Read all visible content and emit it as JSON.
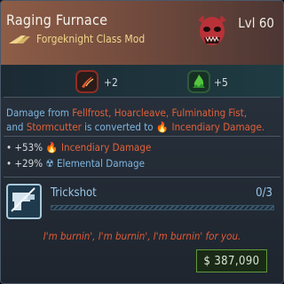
{
  "item": {
    "name": "Raging Furnace",
    "type": "Forgeknight Class Mod",
    "level_text": "Lvl 60"
  },
  "skills": [
    {
      "icon": "fire-claw-icon",
      "count": "+2"
    },
    {
      "icon": "green-flame-icon",
      "count": "+5"
    }
  ],
  "description": {
    "part1": "Damage from ",
    "sources": "Fellfrost, Hoarcleave, Fulminating Fist,",
    "and": "and ",
    "source_last": "Stormcutter",
    "converted": " is converted to ",
    "target": "Incendiary Damage."
  },
  "stats": [
    {
      "value": "+53%",
      "label": "Incendiary Damage",
      "color": "#e0613a"
    },
    {
      "value": "+29%",
      "label": "Elemental Damage",
      "color": "#7fb7e0"
    }
  ],
  "trickshot": {
    "name": "Trickshot",
    "rank": "0/3"
  },
  "flavor": "I'm burnin', I'm burnin', I'm burnin' for you.",
  "price": "387,090",
  "colors": {
    "header_gradient_start": "#8d5d47",
    "header_gradient_end": "#4c3633",
    "incendiary": "#e0613a",
    "elemental": "#7fb7e0",
    "price_border": "#5f9a3a"
  }
}
